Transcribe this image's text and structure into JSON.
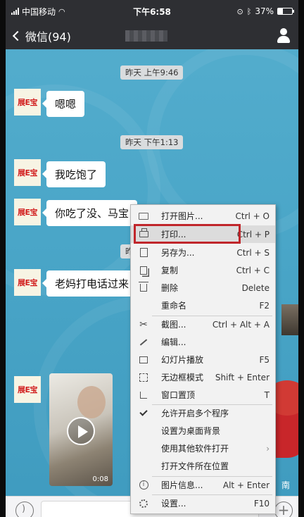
{
  "status_bar": {
    "carrier": "中国移动",
    "time": "下午6:58",
    "battery_percent": "37%",
    "battery_level": 0.37
  },
  "nav": {
    "back_label": "微信(94)"
  },
  "chat": {
    "avatar_text": "展E宝",
    "timestamps": [
      "昨天 上午9:46",
      "昨天 下午1:13",
      "昨天"
    ],
    "messages": [
      "嗯嗯",
      "我吃饱了",
      "你吃了没、马宝",
      "老妈打电话过来"
    ],
    "video_duration": "0:08",
    "right_hint": "南"
  },
  "context_menu": {
    "items": [
      {
        "icon": "folder-open-icon",
        "label": "打开图片...",
        "shortcut": "Ctrl + O"
      },
      {
        "icon": "printer-icon",
        "label": "打印...",
        "shortcut": "Ctrl + P"
      },
      {
        "icon": "save-as-icon",
        "label": "另存为...",
        "shortcut": "Ctrl + S"
      },
      {
        "icon": "copy-icon",
        "label": "复制",
        "shortcut": "Ctrl + C"
      },
      {
        "icon": "trash-icon",
        "label": "删除",
        "shortcut": "Delete"
      },
      {
        "icon": "",
        "label": "重命名",
        "shortcut": "F2"
      },
      {
        "icon": "scissors-icon",
        "label": "截图...",
        "shortcut": "Ctrl + Alt + A"
      },
      {
        "icon": "pen-icon",
        "label": "编辑...",
        "shortcut": ""
      },
      {
        "icon": "slideshow-icon",
        "label": "幻灯片播放",
        "shortcut": "F5"
      },
      {
        "icon": "frameless-icon",
        "label": "无边框模式",
        "shortcut": "Shift + Enter"
      },
      {
        "icon": "pin-icon",
        "label": "窗口置顶",
        "shortcut": "T"
      },
      {
        "icon": "check-icon",
        "label": "允许开启多个程序",
        "shortcut": ""
      },
      {
        "icon": "",
        "label": "设置为桌面背景",
        "shortcut": ""
      },
      {
        "icon": "",
        "label": "使用其他软件打开",
        "shortcut": ""
      },
      {
        "icon": "",
        "label": "打开文件所在位置",
        "shortcut": ""
      },
      {
        "icon": "info-icon",
        "label": "图片信息...",
        "shortcut": "Alt + Enter"
      },
      {
        "icon": "gear-icon",
        "label": "设置...",
        "shortcut": "F10"
      }
    ]
  }
}
